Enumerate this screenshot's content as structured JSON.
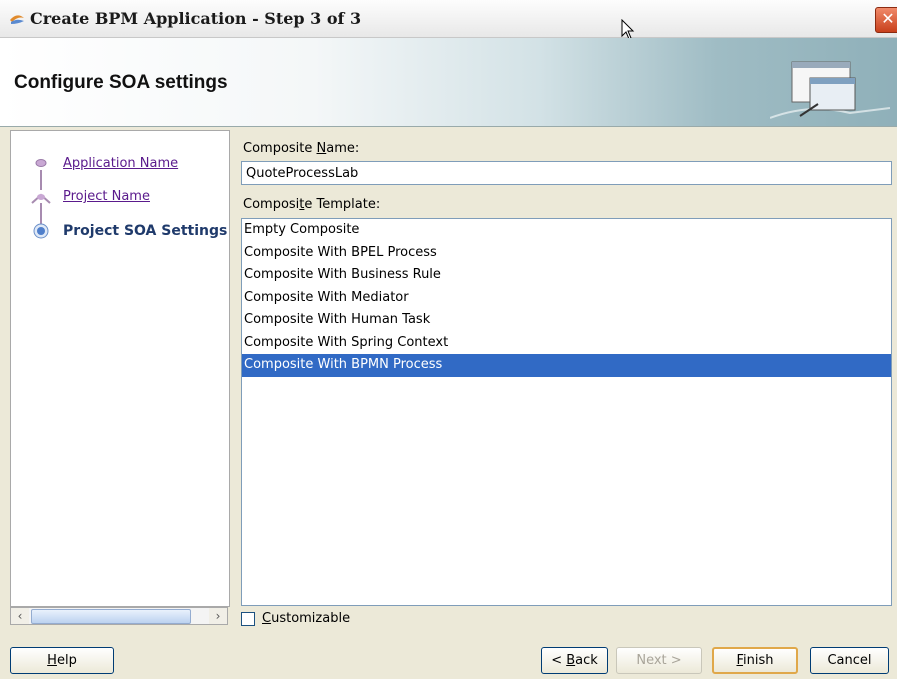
{
  "window": {
    "title": "Create BPM Application - Step 3 of 3"
  },
  "header": {
    "heading": "Configure SOA settings"
  },
  "steps": [
    {
      "label": "Application Name",
      "state": "link"
    },
    {
      "label": "Project Name",
      "state": "link"
    },
    {
      "label": "Project SOA Settings",
      "state": "current"
    }
  ],
  "form": {
    "composite_name_label_pre": "Composite ",
    "composite_name_label_key": "N",
    "composite_name_label_post": "ame:",
    "composite_name_value": "QuoteProcessLab",
    "template_label_pre": "Composi",
    "template_label_key": "t",
    "template_label_post": "e Template:",
    "templates": [
      "Empty Composite",
      "Composite With BPEL Process",
      "Composite With Business Rule",
      "Composite With Mediator",
      "Composite With Human Task",
      "Composite With Spring Context",
      "Composite With BPMN Process"
    ],
    "selected_template_index": 6,
    "customizable_key": "C",
    "customizable_rest": "ustomizable",
    "customizable_checked": false
  },
  "buttons": {
    "help_key": "H",
    "help_rest": "elp",
    "back_pre": "< ",
    "back_key": "B",
    "back_rest": "ack",
    "next": "Next >",
    "finish_key": "F",
    "finish_rest": "inish",
    "cancel": "Cancel"
  },
  "colors": {
    "selection": "#316ac5",
    "link": "#5a1a8c",
    "current_step": "#1f3a6b"
  }
}
